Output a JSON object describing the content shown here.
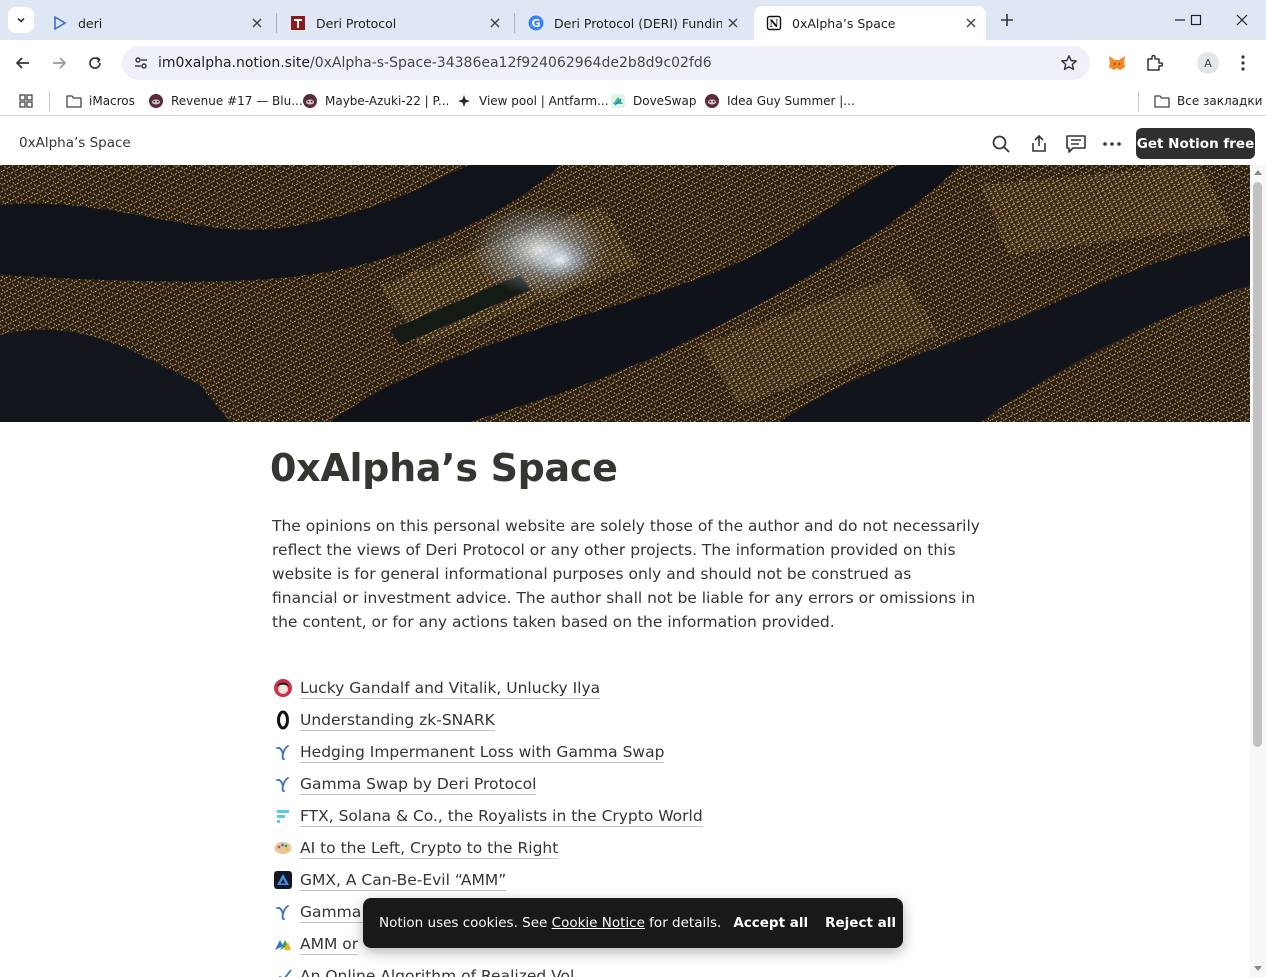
{
  "tabs": [
    {
      "title": "deri",
      "icon": "play-triangle-icon",
      "active": false
    },
    {
      "title": "Deri Protocol",
      "icon": "deri-logo-icon",
      "active": false
    },
    {
      "title": "Deri Protocol (DERI) Funding Ra",
      "icon": "g-logo-icon",
      "active": false
    },
    {
      "title": "0xAlpha’s Space",
      "icon": "notion-logo-icon",
      "active": true
    }
  ],
  "address_bar": {
    "host": "im0xalpha.notion.site",
    "path": "/0xAlpha-s-Space-34386ea12f924062964de2b8d9c02fd6"
  },
  "profile_initial": "A",
  "bookmarks": [
    {
      "label": "iMacros",
      "icon": "folder-icon"
    },
    {
      "label": "Revenue #17 — Blu...",
      "icon": "bluepill-icon"
    },
    {
      "label": "Maybe-Azuki-22 | P...",
      "icon": "bluepill-icon"
    },
    {
      "label": "View pool | Antfarm...",
      "icon": "antfarm-icon"
    },
    {
      "label": "DoveSwap",
      "icon": "doveswap-icon"
    },
    {
      "label": "Idea Guy Summer |...",
      "icon": "bluepill-icon"
    }
  ],
  "all_bookmarks_label": "Все закладки",
  "notion": {
    "breadcrumb": "0xAlpha’s Space",
    "get_notion_label": "Get Notion free",
    "title": "0xAlpha’s Space",
    "description": "The opinions on this personal website are solely those of the author and do not necessarily reflect the views of Deri Protocol or any other projects. The information provided on this website is for general informational purposes only and should not be construed as financial or investment advice. The author shall not be liable for any errors or omissions in the content, or for any actions taken based on the information provided.",
    "pages": [
      {
        "label": "Lucky Gandalf and Vitalik, Unlucky Ilya",
        "icon": "avatar-girl-icon"
      },
      {
        "label": "Understanding zk-SNARK",
        "icon": "zero-icon"
      },
      {
        "label": "Hedging Impermanent Loss with Gamma Swap",
        "icon": "gamma-icon"
      },
      {
        "label": "Gamma Swap by Deri Protocol",
        "icon": "gamma-icon"
      },
      {
        "label": "FTX, Solana & Co., the Royalists in the Crypto World",
        "icon": "ftx-icon"
      },
      {
        "label": "AI to the Left, Crypto to the Right",
        "icon": "palette-icon"
      },
      {
        "label": "GMX, A Can-Be-Evil “AMM”",
        "icon": "gmx-icon"
      },
      {
        "label": "Gamma S",
        "icon": "gamma-icon"
      },
      {
        "label": "AMM or",
        "icon": "amm-icon"
      },
      {
        "label": "An Online Algorithm of Realized Vol",
        "icon": "chart-icon"
      }
    ]
  },
  "cookie_banner": {
    "text_before": "Notion uses cookies. See ",
    "link": "Cookie Notice",
    "text_after": " for details.",
    "accept_label": "Accept all",
    "reject_label": "Reject all"
  }
}
